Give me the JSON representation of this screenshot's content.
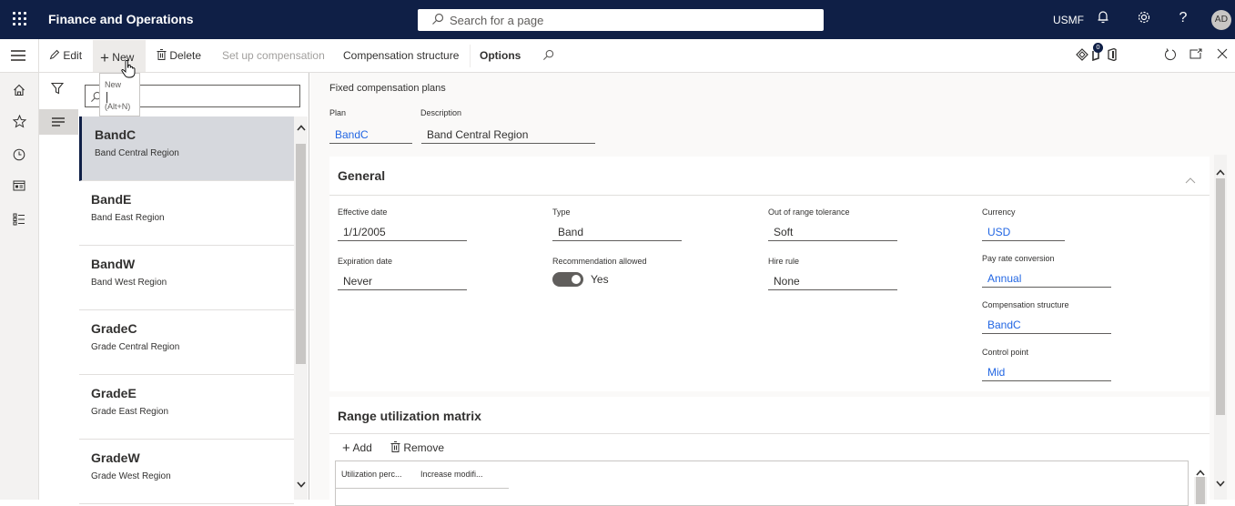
{
  "app": {
    "title": "Finance and Operations",
    "search_placeholder": "Search for a page",
    "company": "USMF",
    "user_initials": "AD"
  },
  "actionbar": {
    "edit": "Edit",
    "new": "New",
    "delete": "Delete",
    "setup_compensation": "Set up compensation",
    "compensation_structure": "Compensation structure",
    "options": "Options",
    "notification_badge": "0"
  },
  "tooltip": {
    "label": "New",
    "shortcut": "(Alt+N)"
  },
  "list": {
    "search_value": "",
    "items": [
      {
        "title": "BandC",
        "subtitle": "Band Central Region",
        "selected": true
      },
      {
        "title": "BandE",
        "subtitle": "Band East Region",
        "selected": false
      },
      {
        "title": "BandW",
        "subtitle": "Band West Region",
        "selected": false
      },
      {
        "title": "GradeC",
        "subtitle": "Grade Central Region",
        "selected": false
      },
      {
        "title": "GradeE",
        "subtitle": "Grade East Region",
        "selected": false
      },
      {
        "title": "GradeW",
        "subtitle": "Grade West Region",
        "selected": false
      }
    ]
  },
  "detail": {
    "page_title": "Fixed compensation plans",
    "plan_label": "Plan",
    "plan_value": "BandC",
    "description_label": "Description",
    "description_value": "Band Central Region",
    "general": {
      "title": "General",
      "effective_date_label": "Effective date",
      "effective_date_value": "1/1/2005",
      "expiration_date_label": "Expiration date",
      "expiration_date_value": "Never",
      "type_label": "Type",
      "type_value": "Band",
      "recommendation_label": "Recommendation allowed",
      "recommendation_value": "Yes",
      "out_of_range_label": "Out of range tolerance",
      "out_of_range_value": "Soft",
      "hire_rule_label": "Hire rule",
      "hire_rule_value": "None",
      "currency_label": "Currency",
      "currency_value": "USD",
      "pay_rate_label": "Pay rate conversion",
      "pay_rate_value": "Annual",
      "comp_structure_label": "Compensation structure",
      "comp_structure_value": "BandC",
      "control_point_label": "Control point",
      "control_point_value": "Mid"
    },
    "range_matrix": {
      "title": "Range utilization matrix",
      "add": "Add",
      "remove": "Remove",
      "columns": [
        "Utilization perc...",
        "Increase modifi..."
      ]
    }
  }
}
